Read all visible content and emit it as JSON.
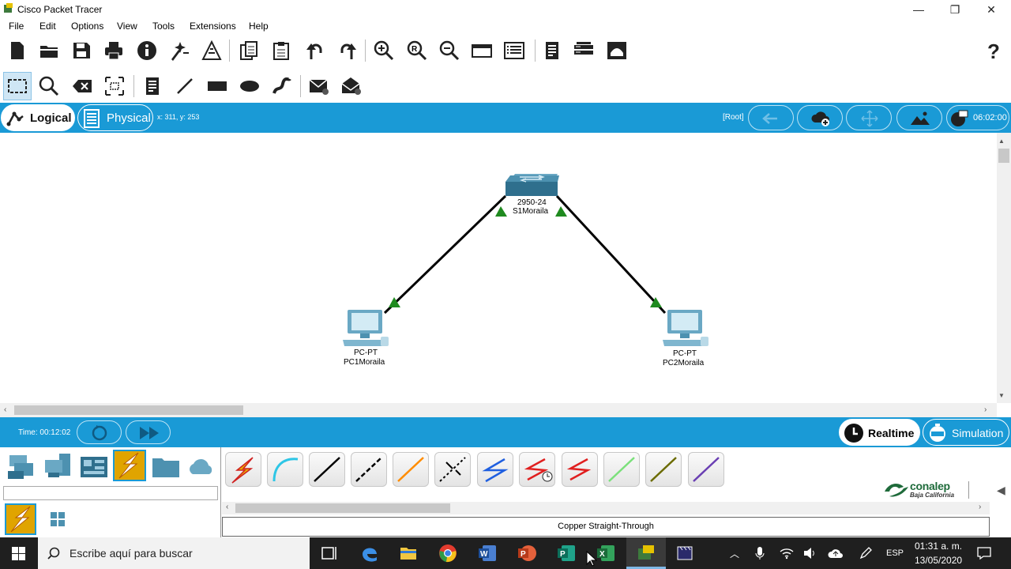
{
  "window": {
    "title": "Cisco Packet Tracer",
    "minimize": "—",
    "restore": "❐",
    "close": "✕"
  },
  "menu": [
    "File",
    "Edit",
    "Options",
    "View",
    "Tools",
    "Extensions",
    "Help"
  ],
  "toolbar_main": [
    "new-icon",
    "open-icon",
    "save-icon",
    "print-icon",
    "info-icon",
    "network-wizard-icon",
    "activity-wizard-icon",
    "copy-icon",
    "paste-icon",
    "undo-icon",
    "redo-icon",
    "zoom-in-icon",
    "zoom-reset-icon",
    "zoom-out-icon",
    "drawing-palette-icon",
    "custom-device-icon",
    "notes-icon",
    "pdu-list-icon",
    "ipc-icon",
    "help-icon"
  ],
  "toolbar_edit": [
    "select-icon",
    "inspect-icon",
    "delete-icon",
    "resize-icon",
    "place-note-icon",
    "draw-line-icon",
    "draw-rectangle-icon",
    "draw-ellipse-icon",
    "freeform-icon",
    "add-simple-pdu-icon",
    "add-complex-pdu-icon"
  ],
  "viewbar": {
    "logical_label": "Logical",
    "physical_label": "Physical",
    "coords": "x: 311, y: 253",
    "root_label": "[Root]",
    "clock": "06:02:00"
  },
  "topology": {
    "devices": [
      {
        "model": "2950-24",
        "name": "S1Moraila",
        "type": "switch"
      },
      {
        "model": "PC-PT",
        "name": "PC1Moraila",
        "type": "pc"
      },
      {
        "model": "PC-PT",
        "name": "PC2Moraila",
        "type": "pc"
      }
    ],
    "link_color": "#000000",
    "port_status_color": "#1f8a1f"
  },
  "bottombar": {
    "time": "Time: 00:12:02",
    "realtime_label": "Realtime",
    "simulation_label": "Simulation"
  },
  "device_categories": [
    "network-devices-icon",
    "end-devices-icon",
    "components-icon",
    "connections-icon",
    "miscellaneous-icon",
    "multiuser-icon"
  ],
  "connection_types": [
    {
      "name": "automatic",
      "color": "#e8b000"
    },
    {
      "name": "console",
      "color": "#2ec6e6"
    },
    {
      "name": "copper-straight-through",
      "color": "#000000"
    },
    {
      "name": "copper-cross-over",
      "color": "#000000"
    },
    {
      "name": "fiber",
      "color": "#ff8c00"
    },
    {
      "name": "phone",
      "color": "#000000"
    },
    {
      "name": "coaxial",
      "color": "#1f5fe0"
    },
    {
      "name": "serial-dce",
      "color": "#e01f1f"
    },
    {
      "name": "serial-dte",
      "color": "#e01f1f"
    },
    {
      "name": "octal",
      "color": "#7be07b"
    },
    {
      "name": "iot-custom",
      "color": "#6b6b00"
    },
    {
      "name": "usb",
      "color": "#6a3fb3"
    }
  ],
  "selected_connection": "Copper Straight-Through",
  "logo": {
    "main": "conalep",
    "sub": "Baja California"
  },
  "taskbar": {
    "search_placeholder": "Escribe aquí para buscar",
    "lang": "ESP",
    "time": "01:31 a. m.",
    "date": "13/05/2020"
  },
  "colors": {
    "accent_blue": "#1a9ad6",
    "taskbar": "#1f1f1f"
  }
}
